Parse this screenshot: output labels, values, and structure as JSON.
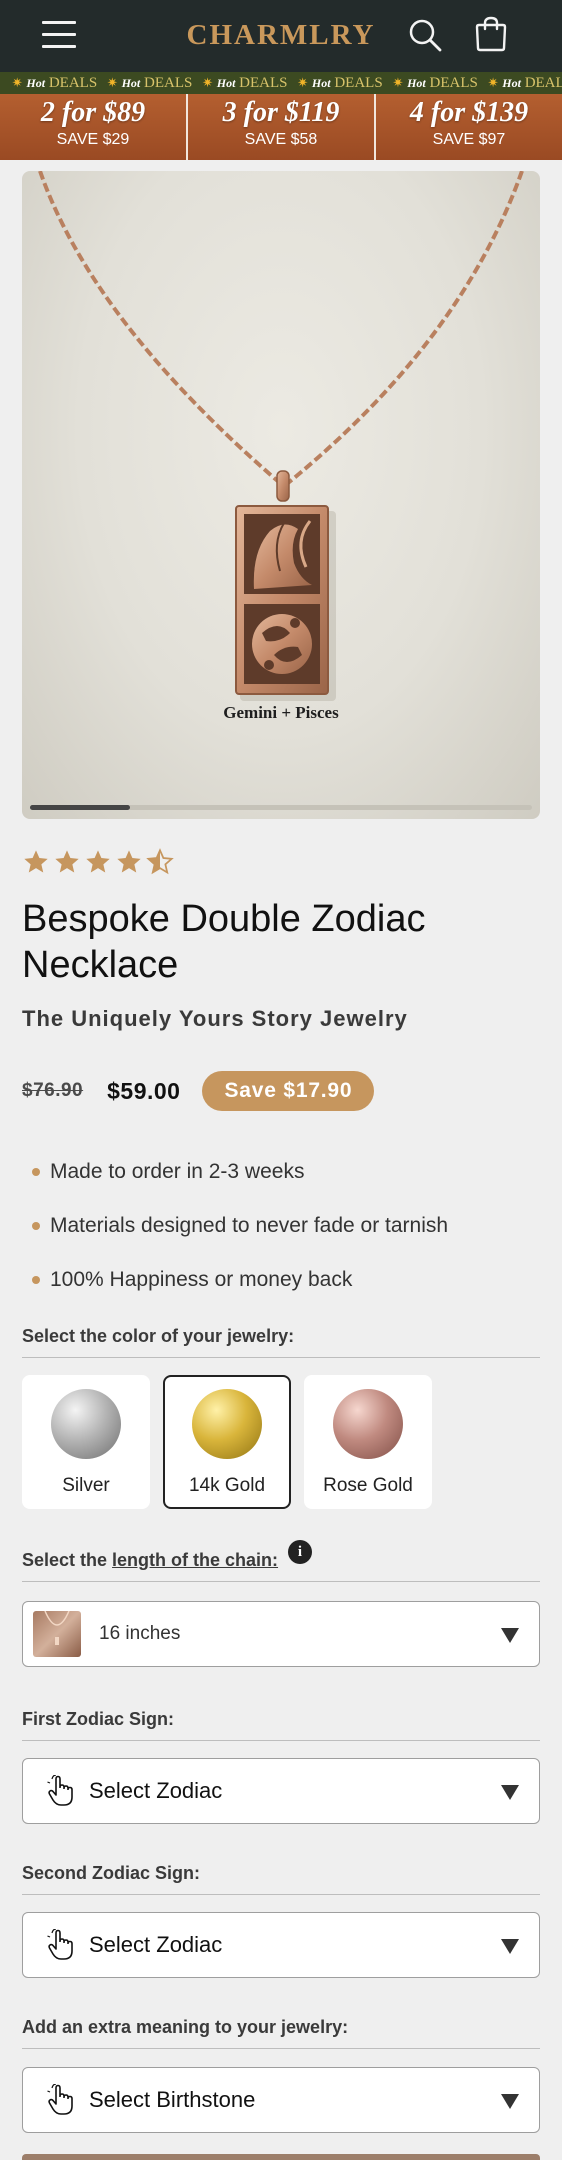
{
  "header": {
    "logo": "CHARMLRY",
    "menu_icon": "hamburger-menu-icon",
    "search_icon": "search-icon",
    "cart_icon": "cart-bag-icon",
    "background": "#232b2b",
    "logo_color": "#c9985b"
  },
  "ticker": {
    "items": [
      {
        "hot": "Hot",
        "text": "DEALS"
      },
      {
        "hot": "Hot",
        "text": "DEALS"
      },
      {
        "hot": "Hot",
        "text": "DEALS"
      },
      {
        "hot": "Hot",
        "text": "DEALS"
      },
      {
        "hot": "Hot",
        "text": "DEALS"
      },
      {
        "hot": "Hot",
        "text": "DEALS"
      }
    ]
  },
  "deals": [
    {
      "offer": "2 for $89",
      "save": "SAVE $29"
    },
    {
      "offer": "3 for $119",
      "save": "SAVE $58"
    },
    {
      "offer": "4 for $139",
      "save": "SAVE $97"
    }
  ],
  "gallery": {
    "caption": "Gemini + Pisces",
    "progress_fraction": 0.2
  },
  "product": {
    "rating": 4.5,
    "title": "Bespoke Double Zodiac Necklace",
    "subtitle": "The Uniquely Yours Story Jewelry",
    "old_price": "$76.90",
    "price": "$59.00",
    "save_badge": "Save $17.90",
    "accent": "#c6965e"
  },
  "bullets": [
    "Made to order in 2-3 weeks",
    "Materials designed to never fade or tarnish",
    "100% Happiness or money back"
  ],
  "color_section": {
    "label": "Select the color of your jewelry:",
    "options": [
      {
        "name": "Silver",
        "selected": false
      },
      {
        "name": "14k Gold",
        "selected": true
      },
      {
        "name": "Rose Gold",
        "selected": false
      }
    ]
  },
  "chain_section": {
    "label_prefix": "Select the ",
    "label_link": "length of the chain:",
    "info_glyph": "i",
    "value": "16 inches"
  },
  "zodiac_first": {
    "label": "First Zodiac Sign:",
    "placeholder": "Select Zodiac"
  },
  "zodiac_second": {
    "label": "Second Zodiac Sign:",
    "placeholder": "Select Zodiac"
  },
  "birthstone": {
    "label": "Add an extra meaning to your jewelry:",
    "placeholder": "Select Birthstone"
  }
}
